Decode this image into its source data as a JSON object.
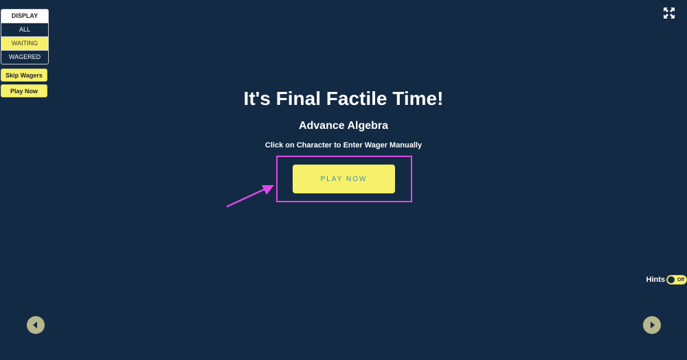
{
  "display_panel": {
    "title": "DISPLAY",
    "options": [
      {
        "label": "ALL"
      },
      {
        "label": "WAITING"
      },
      {
        "label": "WAGERED"
      }
    ]
  },
  "sidebar_buttons": {
    "skip_wagers": "Skip Wagers",
    "play_now": "Play Now"
  },
  "main": {
    "title": "It's Final Factile Time!",
    "subtitle": "Advance Algebra",
    "instruction": "Click on Character to Enter Wager Manually",
    "play_button": "PLAY NOW"
  },
  "hints": {
    "label": "Hints",
    "toggle_state": "Off"
  },
  "icons": {
    "fullscreen": "fullscreen-icon",
    "prev": "chevron-left-icon",
    "next": "chevron-right-icon"
  },
  "colors": {
    "background": "#132a44",
    "accent_yellow": "#f7f06a",
    "annotation_magenta": "#e048e6",
    "nav_button": "#b8b68c"
  }
}
